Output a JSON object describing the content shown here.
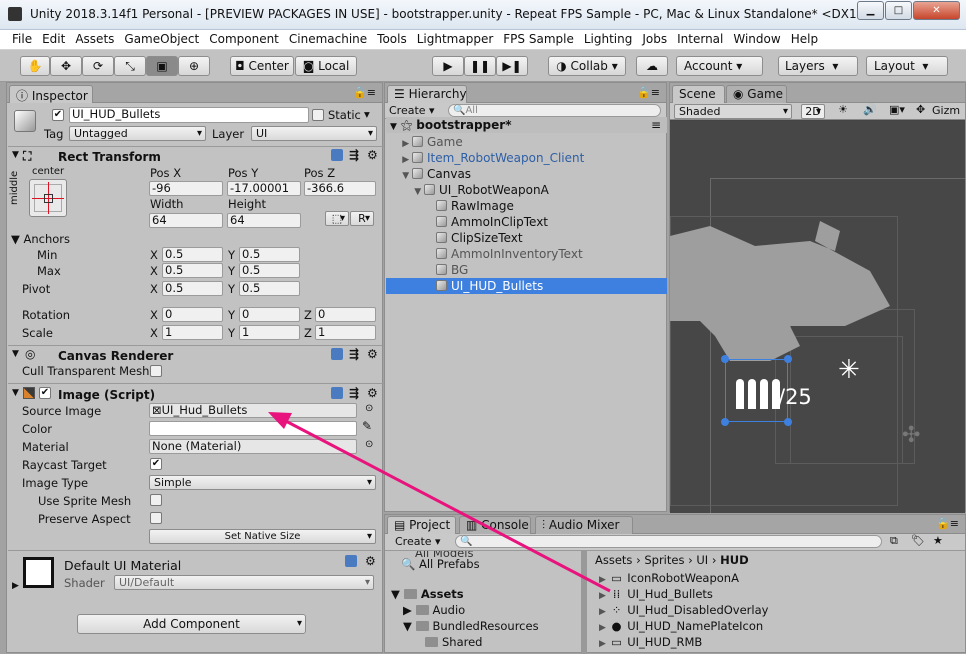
{
  "window": {
    "title": "Unity 2018.3.14f1 Personal - [PREVIEW PACKAGES IN USE] - bootstrapper.unity - Repeat FPS Sample - PC, Mac & Linux Standalone* <DX11>"
  },
  "menu": [
    "File",
    "Edit",
    "Assets",
    "GameObject",
    "Component",
    "Cinemachine",
    "Tools",
    "Lightmapper",
    "FPS Sample",
    "Lighting",
    "Jobs",
    "Internal",
    "Window",
    "Help"
  ],
  "toolbar": {
    "pivot": "Center",
    "space": "Local",
    "collab": "Collab",
    "account": "Account",
    "layers": "Layers",
    "layout": "Layout"
  },
  "inspector": {
    "tab": "Inspector",
    "object_name": "UI_HUD_Bullets",
    "static_label": "Static",
    "tag_label": "Tag",
    "tag_value": "Untagged",
    "layer_label": "Layer",
    "layer_value": "UI",
    "rect": {
      "title": "Rect Transform",
      "anchor_h": "center",
      "anchor_v": "middle",
      "posx_label": "Pos X",
      "posy_label": "Pos Y",
      "posz_label": "Pos Z",
      "posx": "-96",
      "posy": "-17.00001",
      "posz": "-366.6",
      "width_label": "Width",
      "height_label": "Height",
      "width": "64",
      "height": "64",
      "r_btn": "R",
      "anchors_label": "Anchors",
      "min_label": "Min",
      "max_label": "Max",
      "pivot_label": "Pivot",
      "rotation_label": "Rotation",
      "scale_label": "Scale",
      "x": "X",
      "y": "Y",
      "z": "Z",
      "min_x": "0.5",
      "min_y": "0.5",
      "max_x": "0.5",
      "max_y": "0.5",
      "pivot_x": "0.5",
      "pivot_y": "0.5",
      "rot_x": "0",
      "rot_y": "0",
      "rot_z": "0",
      "scale_x": "1",
      "scale_y": "1",
      "scale_z": "1"
    },
    "canvas_renderer": {
      "title": "Canvas Renderer",
      "cull_label": "Cull Transparent Mesh"
    },
    "image": {
      "title": "Image (Script)",
      "source_label": "Source Image",
      "source_value": "UI_Hud_Bullets",
      "color_label": "Color",
      "material_label": "Material",
      "material_value": "None (Material)",
      "raycast_label": "Raycast Target",
      "type_label": "Image Type",
      "type_value": "Simple",
      "sprite_mesh_label": "Use Sprite Mesh",
      "preserve_label": "Preserve Aspect",
      "native_btn": "Set Native Size"
    },
    "material_block": {
      "name": "Default UI Material",
      "shader_label": "Shader",
      "shader_value": "UI/Default"
    },
    "add_component": "Add Component"
  },
  "hierarchy": {
    "tab": "Hierarchy",
    "create": "Create",
    "search_placeholder": "All",
    "scene": "bootstrapper*",
    "items": [
      "Game",
      "Item_RobotWeapon_Client",
      "Canvas",
      "UI_RobotWeaponA",
      "RawImage",
      "AmmoInClipText",
      "ClipSizeText",
      "AmmoInInventoryText",
      "BG",
      "UI_HUD_Bullets"
    ]
  },
  "scene_view": {
    "tab_scene": "Scene",
    "tab_game": "Game",
    "shading": "Shaded",
    "mode_2d": "2D",
    "gizmos": "Gizm",
    "hud_text": "/25"
  },
  "project": {
    "tab_project": "Project",
    "tab_console": "Console",
    "tab_audio": "Audio Mixer",
    "create": "Create",
    "tree": [
      "All Models",
      "All Prefabs",
      "Assets",
      "Audio",
      "BundledResources",
      "Shared"
    ],
    "breadcrumb": [
      "Assets",
      "Sprites",
      "UI",
      "HUD"
    ],
    "assets": [
      "IconRobotWeaponA",
      "UI_Hud_Bullets",
      "UI_Hud_DisabledOverlay",
      "UI_HUD_NamePlateIcon",
      "UI_HUD_RMB"
    ]
  },
  "colors": {
    "accent": "#e8137c",
    "selection": "#3d80df"
  }
}
